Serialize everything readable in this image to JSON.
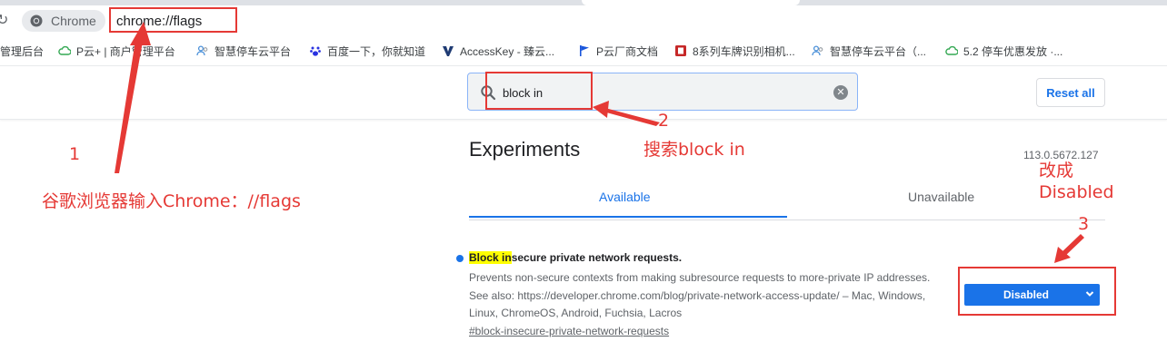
{
  "browser": {
    "chip_label": "Chrome",
    "url": "chrome://flags"
  },
  "bookmarks": [
    {
      "label": "管理后台",
      "icon": "none"
    },
    {
      "label": "P云+ | 商户管理平台",
      "icon": "cloud-icon"
    },
    {
      "label": "智慧停车云平台",
      "icon": "people-icon"
    },
    {
      "label": "百度一下，你就知道",
      "icon": "baidu-paw-icon"
    },
    {
      "label": "AccessKey - 臻云...",
      "icon": "v-logo-icon"
    },
    {
      "label": "P云厂商文档",
      "icon": "flag-icon"
    },
    {
      "label": "8系列车牌识别相机...",
      "icon": "red-square-icon"
    },
    {
      "label": "智慧停车云平台（...",
      "icon": "people-icon"
    },
    {
      "label": "5.2 停车优惠发放 ·...",
      "icon": "cloud-icon"
    }
  ],
  "flags": {
    "search_value": "block in",
    "reset_label": "Reset all",
    "title": "Experiments",
    "version": "113.0.5672.127",
    "tabs": [
      {
        "label": "Available",
        "active": true
      },
      {
        "label": "Unavailable",
        "active": false
      }
    ],
    "experiment": {
      "title_highlight": "Block in",
      "title_rest": "secure private network requests.",
      "description": "Prevents non-secure contexts from making subresource requests to more-private IP addresses. See also: https://developer.chrome.com/blog/private-network-access-update/ – Mac, Windows, Linux, ChromeOS, Android, Fuchsia, Lacros",
      "link": "#block-insecure-private-network-requests",
      "selected_value": "Disabled"
    }
  },
  "annotations": {
    "step1_number": "1",
    "step1_text": "谷歌浏览器输入Chrome：//flags",
    "step2_number": "2",
    "step2_text": "搜索block in",
    "step3_number": "3",
    "step3_text_line1": "改成",
    "step3_text_line2": "Disabled"
  },
  "colors": {
    "accent": "#1a73e8",
    "annotation": "#e53935",
    "highlight": "#ffff00"
  }
}
